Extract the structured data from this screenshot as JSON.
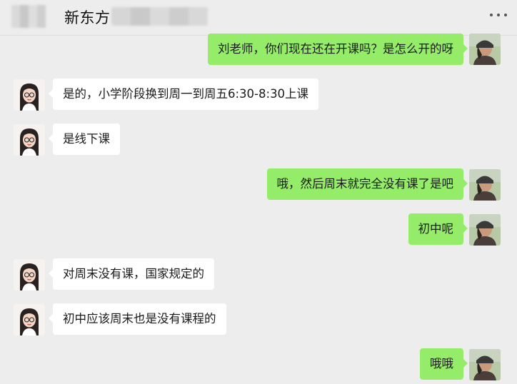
{
  "header": {
    "title": "新东方"
  },
  "messages": [
    {
      "side": "right",
      "text": "刘老师，你们现在还在开课吗？是怎么开的呀"
    },
    {
      "side": "left",
      "text": "是的，小学阶段换到周一到周五6:30-8:30上课"
    },
    {
      "side": "left",
      "text": "是线下课"
    },
    {
      "side": "right",
      "text": "哦，然后周末就完全没有课了是吧"
    },
    {
      "side": "right",
      "text": "初中呢"
    },
    {
      "side": "left",
      "text": "对周末没有课，国家规定的"
    },
    {
      "side": "left",
      "text": "初中应该周末也是没有课程的"
    },
    {
      "side": "right",
      "text": "哦哦"
    }
  ],
  "avatars": {
    "teacher": "teacher-avatar",
    "user": "user-avatar"
  },
  "colors": {
    "background": "#ededed",
    "bubble_left": "#ffffff",
    "bubble_right": "#95ec69"
  }
}
